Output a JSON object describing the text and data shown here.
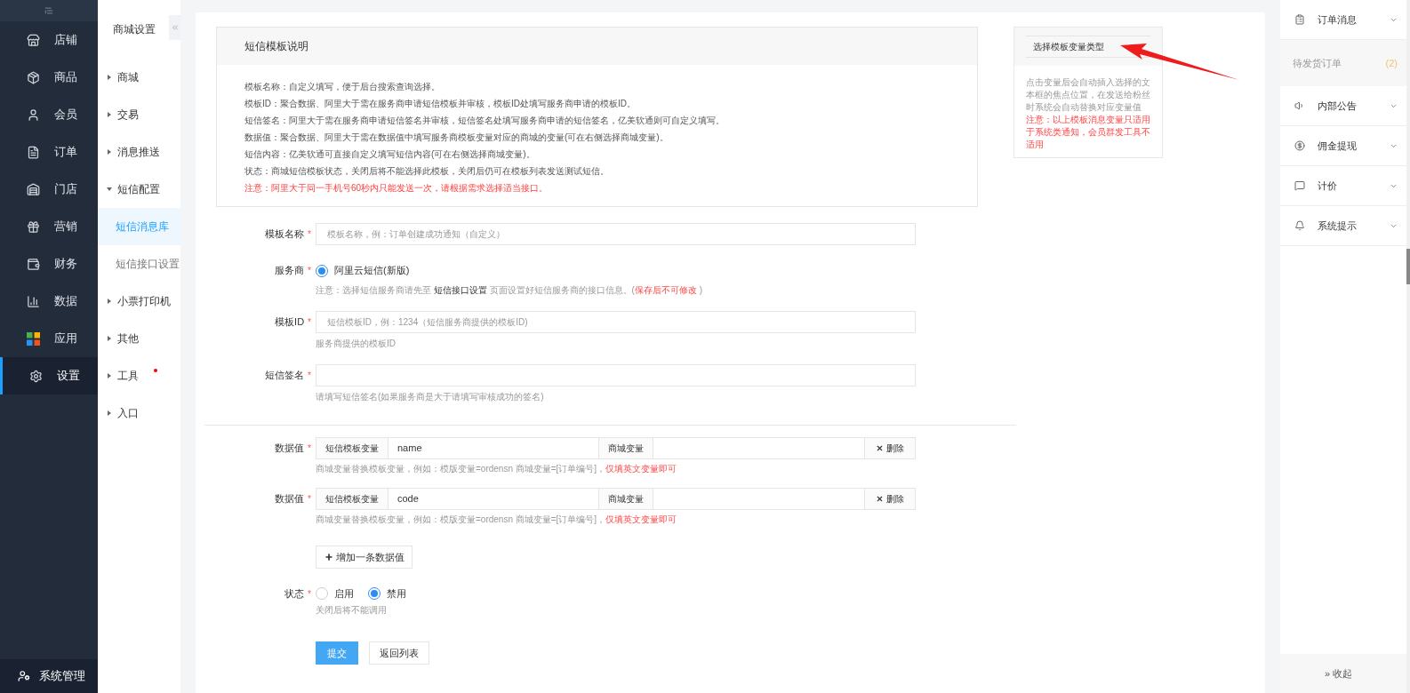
{
  "sidebar": {
    "items": [
      {
        "label": "店铺",
        "selected": false
      },
      {
        "label": "商品",
        "selected": false
      },
      {
        "label": "会员",
        "selected": false
      },
      {
        "label": "订单",
        "selected": false
      },
      {
        "label": "门店",
        "selected": false
      },
      {
        "label": "营销",
        "selected": false
      },
      {
        "label": "财务",
        "selected": false
      },
      {
        "label": "数据",
        "selected": false
      },
      {
        "label": "应用",
        "selected": false
      },
      {
        "label": "设置",
        "selected": true
      }
    ],
    "footer": "系统管理"
  },
  "subnav": {
    "title": "商城设置",
    "items": [
      {
        "label": "商城",
        "expanded": false,
        "badge": false
      },
      {
        "label": "交易",
        "expanded": false,
        "badge": false
      },
      {
        "label": "消息推送",
        "expanded": false,
        "badge": false
      },
      {
        "label": "短信配置",
        "expanded": true,
        "badge": false,
        "children": [
          {
            "label": "短信消息库",
            "selected": true
          },
          {
            "label": "短信接口设置",
            "selected": false
          }
        ]
      },
      {
        "label": "小票打印机",
        "expanded": false,
        "badge": false
      },
      {
        "label": "其他",
        "expanded": false,
        "badge": false
      },
      {
        "label": "工具",
        "expanded": false,
        "badge": true
      },
      {
        "label": "入口",
        "expanded": false,
        "badge": false
      }
    ]
  },
  "info_box": {
    "title": "短信模板说明",
    "lines": [
      {
        "text": "模板名称：自定义填写，便于后台搜索查询选择。",
        "warning": false
      },
      {
        "text": "模板ID：聚合数据、阿里大于需在服务商申请短信模板并审核，模板ID处填写服务商申请的模板ID。",
        "warning": false
      },
      {
        "text": "短信签名：阿里大于需在服务商申请短信签名并审核，短信签名处填写服务商申请的短信签名，亿美软通则可自定义填写。",
        "warning": false
      },
      {
        "text": "数据值：聚合数据、阿里大于需在数据值中填写服务商模板变量对应的商城的变量(可在右侧选择商城变量)。",
        "warning": false
      },
      {
        "text": "短信内容：亿美软通可直接自定义填写短信内容(可在右侧选择商城变量)。",
        "warning": false
      },
      {
        "text": "状态：商城短信模板状态，关闭后将不能选择此模板，关闭后仍可在模板列表发送测试短信。",
        "warning": false
      },
      {
        "text": "注意：阿里大于同一手机号60秒内只能发送一次，请根据需求选择适当接口。",
        "warning": true
      }
    ]
  },
  "form": {
    "fields": [
      {
        "kind": "input",
        "label": "模板名称",
        "required_mark": "*",
        "placeholder": "模板名称，例：订单创建成功通知（自定义）"
      },
      {
        "kind": "radio",
        "label": "服务商",
        "required_mark": "*",
        "options": [
          {
            "label": "阿里云短信(新版)",
            "selected": true
          }
        ],
        "note": [
          {
            "text": "注意：选择短信服务商请先至 ",
            "kind": "plain"
          },
          {
            "text": "短信接口设置",
            "kind": "link"
          },
          {
            "text": " 页面设置好短信服务商的接口信息。(",
            "kind": "plain"
          },
          {
            "text": "保存后不可修改",
            "kind": "warning"
          },
          {
            "text": " )",
            "kind": "plain"
          }
        ]
      },
      {
        "kind": "input",
        "label": "模板ID",
        "required_mark": "*",
        "placeholder": "短信模板ID，例：1234（短信服务商提供的模板ID)",
        "help": "服务商提供的模板ID"
      },
      {
        "kind": "input",
        "label": "短信签名",
        "required_mark": "*",
        "help": "请填写短信签名(如果服务商是大于请填写审核成功的签名)"
      }
    ],
    "data_rows": [
      {
        "label": "数据值",
        "required_mark": "*",
        "var_label": "短信模板变量",
        "var_value": "name",
        "mall_label": "商城变量",
        "delete": "删除",
        "help": "商城变量替换模板变量，例如：模版变量=ordensn 商城变量=[订单编号]，",
        "help_warning": "仅填英文变量即可"
      },
      {
        "label": "数据值",
        "required_mark": "*",
        "var_label": "短信模板变量",
        "var_value": "code",
        "mall_label": "商城变量",
        "delete": "删除",
        "help": "商城变量替换模板变量，例如：模版变量=ordensn 商城变量=[订单编号]，",
        "help_warning": "仅填英文变量即可"
      }
    ],
    "add_button": "增加一条数据值",
    "status": {
      "label": "状态",
      "required_mark": "*",
      "options": [
        {
          "label": "启用",
          "selected": false
        },
        {
          "label": "禁用",
          "selected": true
        }
      ],
      "help": "关闭后将不能调用"
    },
    "buttons": [
      {
        "label": "提交",
        "kind": "primary"
      },
      {
        "label": "返回列表",
        "kind": "default"
      }
    ]
  },
  "variable_card": {
    "title": "选择模板变量类型",
    "description": "点击变量后会自动插入选择的文本框的焦点位置，在发送给粉丝时系统会自动替换对应变量值",
    "warning": "注意：以上模板消息变量只适用于系统类通知，会员群发工具不适用"
  },
  "notice_panel": {
    "items": [
      {
        "kind": "section",
        "label": "订单消息"
      },
      {
        "kind": "sub",
        "label": "待发货订单",
        "count": "(2)"
      },
      {
        "kind": "section",
        "label": "内部公告"
      },
      {
        "kind": "section",
        "label": "佣金提现"
      },
      {
        "kind": "section",
        "label": "计价"
      },
      {
        "kind": "section",
        "label": "系统提示"
      }
    ],
    "collapse": "» 收起"
  }
}
